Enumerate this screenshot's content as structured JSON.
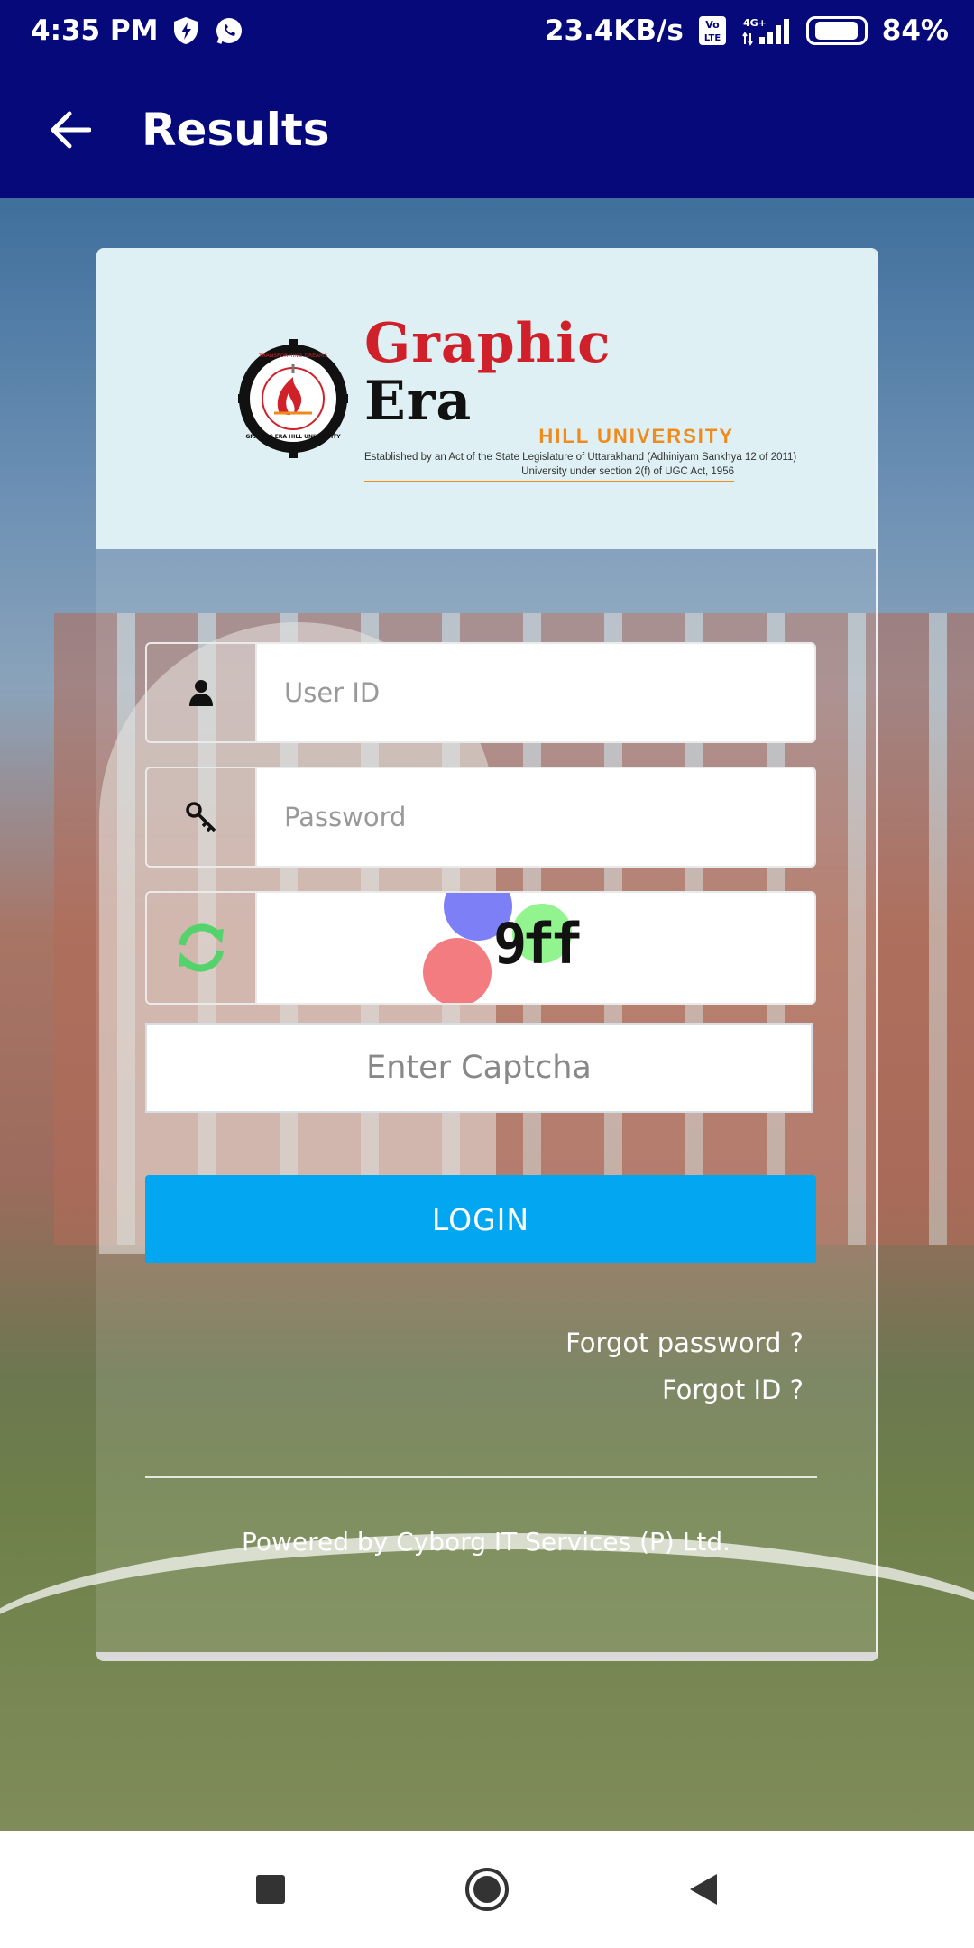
{
  "status_bar": {
    "time": "4:35 PM",
    "net_speed": "23.4KB/s",
    "volte": "Vo LTE",
    "signal": "4G+",
    "battery": "84%",
    "battery_level": 0.84,
    "icons": [
      "shield-bolt-icon",
      "whatsapp-icon",
      "volte-icon",
      "signal-icon",
      "battery-icon"
    ]
  },
  "app_bar": {
    "title": "Results",
    "back_icon": "arrow-back-icon"
  },
  "logo": {
    "name_part1": "Graphic",
    "name_part2": "Era",
    "subtitle": "HILL UNIVERSITY",
    "established": "Established by an Act of the State Legislature of Uttarakhand (Adhiniyam Sankhya 12 of 2011)",
    "ugc": "University under section 2(f) of UGC Act, 1956",
    "seal_text": "GRAPHIC ERA HILL UNIVERSITY"
  },
  "form": {
    "user_id_placeholder": "User ID",
    "password_placeholder": "Password",
    "captcha_text": "9ff",
    "captcha_placeholder": "Enter Captcha",
    "login_label": "LOGIN",
    "forgot_password": "Forgot password ?",
    "forgot_id": "Forgot ID ?",
    "powered_by": "Powered by Cyborg IT Services (P) Ltd."
  },
  "colors": {
    "app_bar": "#05097a",
    "login_button": "#03a6f0",
    "refresh_icon": "#54d26b",
    "brand_red": "#d0212a",
    "brand_orange": "#f08a1a"
  },
  "nav_bar": {
    "icons": [
      "recents-square-icon",
      "home-circle-icon",
      "back-triangle-icon"
    ]
  }
}
